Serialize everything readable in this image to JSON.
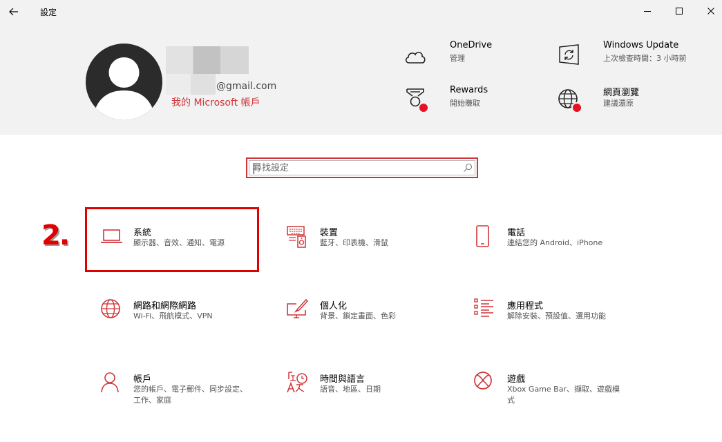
{
  "window": {
    "title": "設定"
  },
  "account": {
    "email_suffix": "@gmail.com",
    "link_label": "我的 Microsoft 帳戶"
  },
  "header_items": {
    "onedrive": {
      "title": "OneDrive",
      "subtitle": "管理"
    },
    "windows_update": {
      "title": "Windows Update",
      "subtitle": "上次檢查時間：3 小時前"
    },
    "rewards": {
      "title": "Rewards",
      "subtitle": "開始賺取"
    },
    "web_browsing": {
      "title": "網頁瀏覽",
      "subtitle": "建議還原"
    }
  },
  "search": {
    "placeholder": "尋找設定"
  },
  "annotation": {
    "step": "2."
  },
  "tiles": {
    "system": {
      "title": "系統",
      "desc": "顯示器、音效、通知、電源"
    },
    "devices": {
      "title": "裝置",
      "desc": "藍牙、印表機、滑鼠"
    },
    "phone": {
      "title": "電話",
      "desc": "連結您的 Android、iPhone"
    },
    "network": {
      "title": "網路和網際網路",
      "desc": "Wi-Fi、飛航模式、VPN"
    },
    "personalization": {
      "title": "個人化",
      "desc": "背景、鎖定畫面、色彩"
    },
    "apps": {
      "title": "應用程式",
      "desc": "解除安裝、預設值、選用功能"
    },
    "accounts": {
      "title": "帳戶",
      "desc": "您的帳戶、電子郵件、同步設定、工作、家庭"
    },
    "time_language": {
      "title": "時間與語言",
      "desc": "語音、地區、日期"
    },
    "gaming": {
      "title": "遊戲",
      "desc": "Xbox Game Bar、擷取、遊戲模式"
    }
  },
  "colors": {
    "accent": "#d13438",
    "annotation_red": "#e00000",
    "header_bg": "#f2f2f2",
    "notification_dot": "#e81123"
  }
}
